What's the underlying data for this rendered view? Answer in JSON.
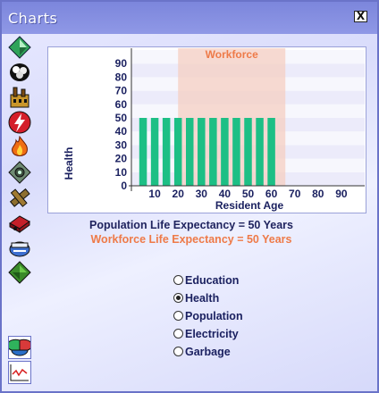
{
  "window": {
    "title": "Charts",
    "close_glyph": "X"
  },
  "toolbar": {
    "items": [
      {
        "icon": "green-crystal-icon"
      },
      {
        "icon": "black-steam-icon"
      },
      {
        "icon": "factory-icon"
      },
      {
        "icon": "lightning-icon"
      },
      {
        "icon": "fire-icon"
      },
      {
        "icon": "gear-icon"
      },
      {
        "icon": "water-pipe-icon"
      },
      {
        "icon": "truck-icon"
      },
      {
        "icon": "garbage-icon"
      },
      {
        "icon": "land-icon"
      }
    ],
    "bottom": [
      {
        "icon": "pie-chart-icon",
        "selected": true
      },
      {
        "icon": "line-graph-icon",
        "selected": false
      }
    ]
  },
  "chart_data": {
    "type": "bar",
    "categories": [
      "5",
      "10",
      "15",
      "20",
      "25",
      "30",
      "35",
      "40",
      "45",
      "50",
      "55",
      "60"
    ],
    "values": [
      50,
      50,
      50,
      50,
      50,
      50,
      50,
      50,
      50,
      50,
      50,
      50
    ],
    "x_ticks": [
      "10",
      "20",
      "30",
      "40",
      "50",
      "60",
      "70",
      "80",
      "90"
    ],
    "y_ticks": [
      "0",
      "10",
      "20",
      "30",
      "40",
      "50",
      "60",
      "70",
      "80",
      "90"
    ],
    "xlabel": "Resident Age",
    "ylabel": "Health",
    "xlim": [
      0,
      100
    ],
    "ylim": [
      0,
      100
    ],
    "band_label": "Workforce",
    "band_range": [
      20,
      66
    ],
    "bar_color": "#1dbf85",
    "band_color": "#f6cfc2"
  },
  "summary": {
    "population": "Population Life Expectancy = 50 Years",
    "workforce": "Workforce Life Expectancy = 50 Years",
    "population_color": "#20245e",
    "workforce_color": "#ee7a48"
  },
  "options": [
    {
      "label": "Education",
      "checked": false
    },
    {
      "label": "Health",
      "checked": true
    },
    {
      "label": "Population",
      "checked": false
    },
    {
      "label": "Electricity",
      "checked": false
    },
    {
      "label": "Garbage",
      "checked": false
    }
  ]
}
